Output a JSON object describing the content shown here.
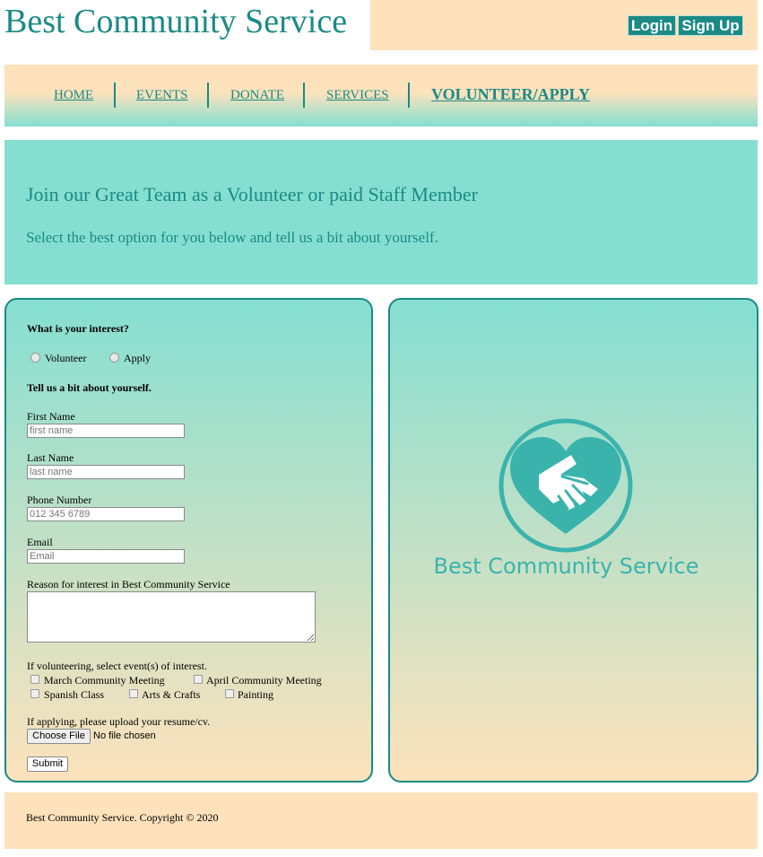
{
  "site": {
    "title": "Best Community Service"
  },
  "auth": {
    "login_label": "Login",
    "signup_label": "Sign Up"
  },
  "nav": {
    "items": [
      {
        "label": "HOME"
      },
      {
        "label": "EVENTS"
      },
      {
        "label": "DONATE"
      },
      {
        "label": "SERVICES"
      },
      {
        "label": "VOLUNTEER/APPLY"
      }
    ]
  },
  "hero": {
    "heading": "Join our Great Team as a Volunteer or paid Staff Member",
    "subheading": "Select the best option for you below and tell us a bit about yourself."
  },
  "form": {
    "interest_question": "What is your interest?",
    "interest_options": [
      "Volunteer",
      "Apply"
    ],
    "about_heading": "Tell us a bit about yourself.",
    "first_name": {
      "label": "First Name",
      "placeholder": "first name"
    },
    "last_name": {
      "label": "Last Name",
      "placeholder": "last name"
    },
    "phone": {
      "label": "Phone Number",
      "placeholder": "012 345 6789"
    },
    "email": {
      "label": "Email",
      "placeholder": "Email"
    },
    "reason_label": "Reason for interest in Best Community Service",
    "events_prompt": "If volunteering, select event(s) of interest.",
    "events": [
      "March Community Meeting",
      "April Community Meeting",
      "Spanish Class",
      "Arts & Crafts",
      "Painting"
    ],
    "upload_prompt": "If applying, please upload your resume/cv.",
    "file_button_label": "Choose File",
    "file_status": "No file chosen",
    "submit_label": "Submit"
  },
  "logo": {
    "text": "Best Community Service",
    "color": "#3bb3ad",
    "icon": "handshake-heart-icon"
  },
  "footer": {
    "text": "Best Community Service. Copyright © 2020"
  },
  "colors": {
    "accent": "#1a8a85",
    "peach": "#fde2bc",
    "mint": "#85dfd1"
  }
}
